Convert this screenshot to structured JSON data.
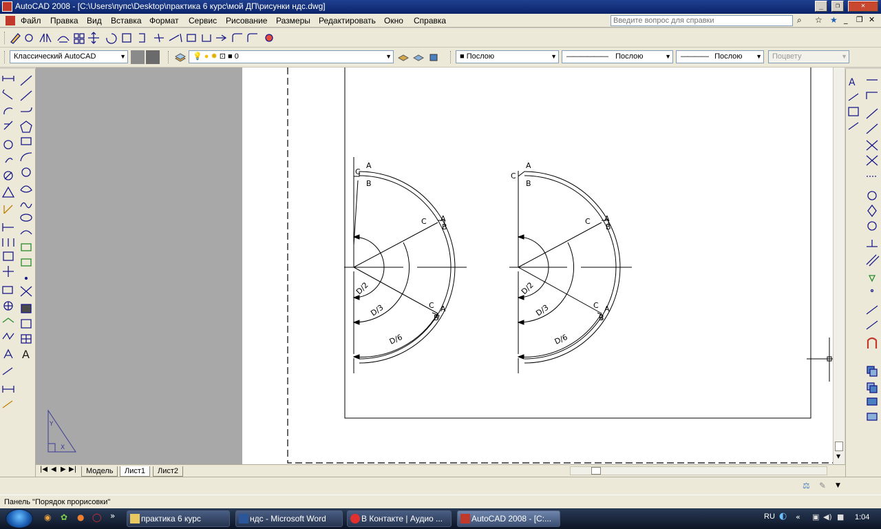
{
  "window": {
    "title": "AutoCAD 2008 - [C:\\Users\\пупс\\Desktop\\практика 6 курс\\мой ДП\\рисунки ндс.dwg]",
    "controls": [
      "_",
      "❐",
      "✕"
    ],
    "doc_controls": [
      "_",
      "❐",
      "✕"
    ]
  },
  "menu": {
    "items": [
      "Файл",
      "Правка",
      "Вид",
      "Вставка",
      "Формат",
      "Сервис",
      "Рисование",
      "Размеры",
      "Редактировать",
      "Окно",
      "Справка"
    ],
    "help_placeholder": "Введите вопрос для справки"
  },
  "toolbar2": {
    "workspace": "Классический AutoCAD",
    "layer": "0",
    "color": "Послою",
    "linetype": "Послою",
    "lineweight": "Послою",
    "plotstyle": "Поцвету"
  },
  "drawing": {
    "left_labels": {
      "c_top": "C",
      "a_top": "A",
      "b_top": "B",
      "c_mid": "C",
      "a_mid": "A",
      "b_mid": "B",
      "c_low": "C",
      "a_low": "A",
      "b_low": "B"
    },
    "right_labels": {
      "c_top": "C",
      "a_top": "A",
      "b_top": "B",
      "c_mid": "C",
      "a_mid": "A",
      "b_mid": "B",
      "c_low": "C",
      "a_low": "A",
      "b_low": "B"
    },
    "dim_d2": "D/2",
    "dim_d3": "D/3",
    "dim_d6": "D/6"
  },
  "tabs": {
    "model": "Модель",
    "sheet1": "Лист1",
    "sheet2": "Лист2"
  },
  "status": {
    "text": "Панель \"Порядок прорисовки\""
  },
  "taskbar": {
    "tasks": [
      {
        "label": "практика 6 курс"
      },
      {
        "label": "ндс - Microsoft Word"
      },
      {
        "label": "В Контакте | Аудио ..."
      },
      {
        "label": "AutoCAD 2008 - [C:..."
      }
    ],
    "lang": "RU",
    "clock": "1:04",
    "more": "»"
  },
  "colors": {
    "title_bar": "#0a246a",
    "paper": "#ffffff",
    "paper_background": "#a8a8a8"
  }
}
